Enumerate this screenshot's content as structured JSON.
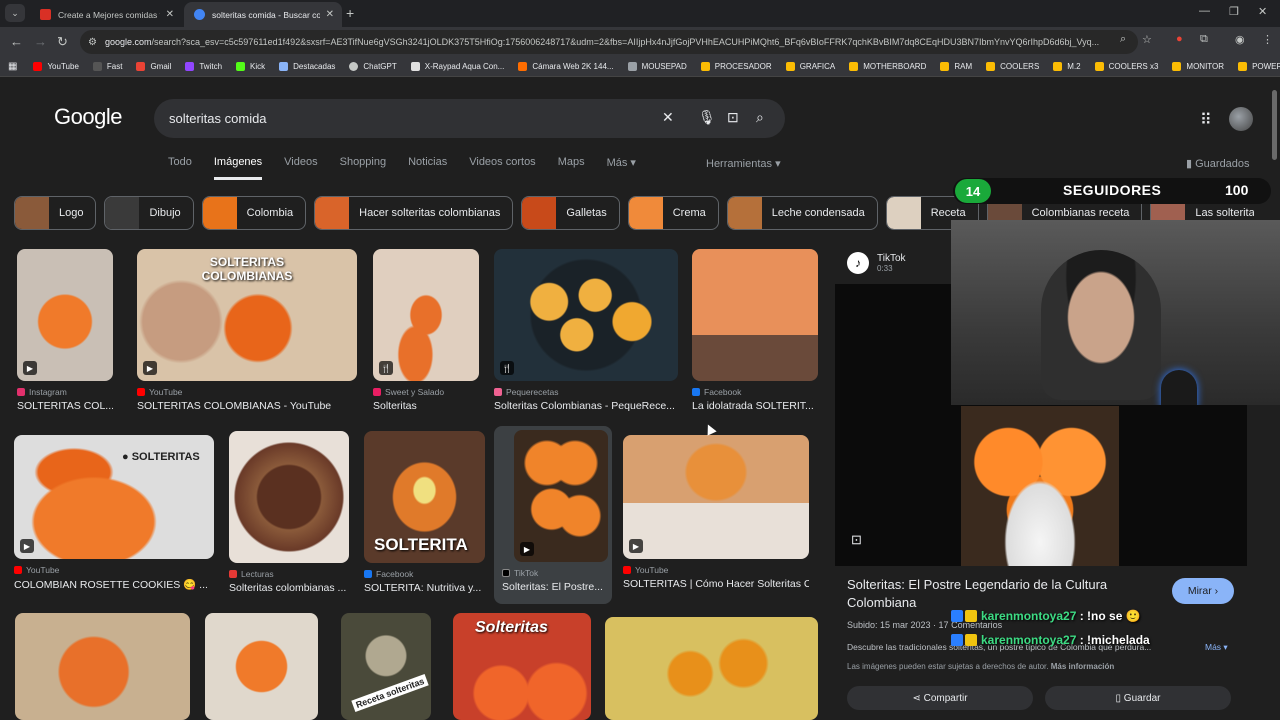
{
  "browser": {
    "tabs": [
      {
        "title": "Create a Mejores comidas típic",
        "favicon_color": "#d93025",
        "active": false
      },
      {
        "title": "solteritas comida - Buscar con G",
        "favicon_color": "#4285f4",
        "active": true
      }
    ],
    "url_host": "google.com",
    "url_rest": "/search?sca_esv=c5c597611ed1f492&sxsrf=AE3TifNue6gVSGh3241jOLDK375T5HfiOg:1756006248717&udm=2&fbs=AIIjpHx4nJjfGojPVHhEACUHPiMQht6_BFq6vBIoFFRK7qchKBvBIM7dq8CEqHDU3BN7IbmYnvYQ6rIhpD6d6bj_Vyq..."
  },
  "bookmarks": [
    {
      "label": "YouTube",
      "color": "#ff0000"
    },
    {
      "label": "Fast",
      "color": "#555555"
    },
    {
      "label": "Gmail",
      "color": "#ea4335"
    },
    {
      "label": "Twitch",
      "color": "#9146ff"
    },
    {
      "label": "Kick",
      "color": "#53fc18"
    },
    {
      "label": "Destacadas",
      "color": "#8ab4f8"
    },
    {
      "label": "ChatGPT",
      "color": "#c4c7c5"
    },
    {
      "label": "X-Raypad Aqua Con...",
      "color": "#e0e0e0"
    },
    {
      "label": "Cámara Web 2K 144...",
      "color": "#ff6d00"
    },
    {
      "label": "MOUSEPAD",
      "color": "#9aa0a6"
    },
    {
      "label": "PROCESADOR",
      "color": "#fbbc04"
    },
    {
      "label": "GRAFICA",
      "color": "#fbbc04"
    },
    {
      "label": "MOTHERBOARD",
      "color": "#fbbc04"
    },
    {
      "label": "RAM",
      "color": "#fbbc04"
    },
    {
      "label": "COOLERS",
      "color": "#fbbc04"
    },
    {
      "label": "M.2",
      "color": "#fbbc04"
    },
    {
      "label": "COOLERS x3",
      "color": "#fbbc04"
    },
    {
      "label": "MONITOR",
      "color": "#fbbc04"
    },
    {
      "label": "POWER SUPPLY",
      "color": "#fbbc04"
    }
  ],
  "google": {
    "logo": "Google",
    "query": "solteritas comida",
    "tabs": [
      "Todo",
      "Imágenes",
      "Videos",
      "Shopping",
      "Noticias",
      "Videos cortos",
      "Maps",
      "Más ▾"
    ],
    "active_tab": "Imágenes",
    "tools": "Herramientas ▾",
    "saved": "Guardados"
  },
  "chips": [
    {
      "label": "Logo",
      "color": "#8a5a3a"
    },
    {
      "label": "Dibujo",
      "color": "#3a3a3a"
    },
    {
      "label": "Colombia",
      "color": "#e8731a"
    },
    {
      "label": "Hacer solteritas colombianas",
      "color": "#d9642a"
    },
    {
      "label": "Galletas",
      "color": "#c84a1a"
    },
    {
      "label": "Crema",
      "color": "#f08a3a"
    },
    {
      "label": "Leche condensada",
      "color": "#b5703a"
    },
    {
      "label": "Receta",
      "color": "#ddd0c0"
    },
    {
      "label": "Colombianas receta",
      "color": "#6a4a3a"
    },
    {
      "label": "Las solteritas",
      "color": "#a06050"
    }
  ],
  "results_row1": [
    {
      "source": "Instagram",
      "title": "SOLTERITAS COL...",
      "src_color": "#e1306c",
      "img_color": "#c9bfb5",
      "badge": "▶"
    },
    {
      "source": "YouTube",
      "title": "SOLTERITAS COLOMBIANAS - YouTube",
      "src_color": "#ff0000",
      "img_color": "#d9c3a8",
      "badge": "▶",
      "overtext": "SOLTERITAS COLOMBIANAS"
    },
    {
      "source": "Sweet y Salado",
      "title": "Solteritas",
      "src_color": "#e91e63",
      "img_color": "#e0cfbf",
      "badge": "🍴"
    },
    {
      "source": "Pequerecetas",
      "title": "Solteritas Colombianas - PequeRece...",
      "src_color": "#f06292",
      "img_color": "#22303a",
      "badge": "🍴"
    },
    {
      "source": "Facebook",
      "title": "La idolatrada SOLTERIT...",
      "src_color": "#1877f2",
      "img_color": "#e8905a",
      "badge": ""
    }
  ],
  "results_row2": [
    {
      "source": "YouTube",
      "title": "COLOMBIAN ROSETTE COOKIES 😋 ...",
      "src_color": "#ff0000",
      "img_color": "#e8651a",
      "badge": "▶",
      "overtext": "● SOLTERITAS"
    },
    {
      "source": "Lecturas",
      "title": "Solteritas colombianas ...",
      "src_color": "#e53935",
      "img_color": "#6a3a28",
      "badge": ""
    },
    {
      "source": "Facebook",
      "title": "SOLTERITA: Nutritiva y...",
      "src_color": "#1877f2",
      "img_color": "#e07a2a",
      "badge": "",
      "overtext": "SOLTERITA"
    },
    {
      "source": "TikTok",
      "title": "Solteritas: El Postre...",
      "src_color": "#000000",
      "img_color": "#f0842a",
      "badge": "▶"
    },
    {
      "source": "YouTube",
      "title": "SOLTERITAS | Cómo Hacer Solteritas C...",
      "src_color": "#ff0000",
      "img_color": "#d8a070",
      "badge": "▶"
    }
  ],
  "results_row3": [
    {
      "img_color": "#e8702a"
    },
    {
      "img_color": "#f07a2a"
    },
    {
      "img_color": "#6a6a5a",
      "overtext": "Receta solteritas"
    },
    {
      "img_color": "#e8552a",
      "overtext": "Solteritas"
    },
    {
      "img_color": "#d8c060"
    }
  ],
  "preview": {
    "platform": "TikTok",
    "duration": "0:33",
    "title": "Solteritas: El Postre Legendario de la Cultura Colombiana",
    "visit_button": "Mirar ›",
    "subtitle": "Subido: 15 mar 2023 · 17 Comentarios",
    "description": "Descubre las tradicionales solteritas, un postre típico de Colombia que perdura...",
    "more": "Más ▾",
    "copyright": "Las imágenes pueden estar sujetas a derechos de autor.",
    "more_info": "Más información",
    "share": "⋖ Compartir",
    "save": "▯ Guardar"
  },
  "stream": {
    "followers_current": "14",
    "followers_label": "SEGUIDORES",
    "followers_goal": "100",
    "chat": [
      {
        "user": "karenmontoya27",
        "text": " : !no se 🙂"
      },
      {
        "user": "karenmontoya27",
        "text": " : !michelada"
      }
    ]
  }
}
